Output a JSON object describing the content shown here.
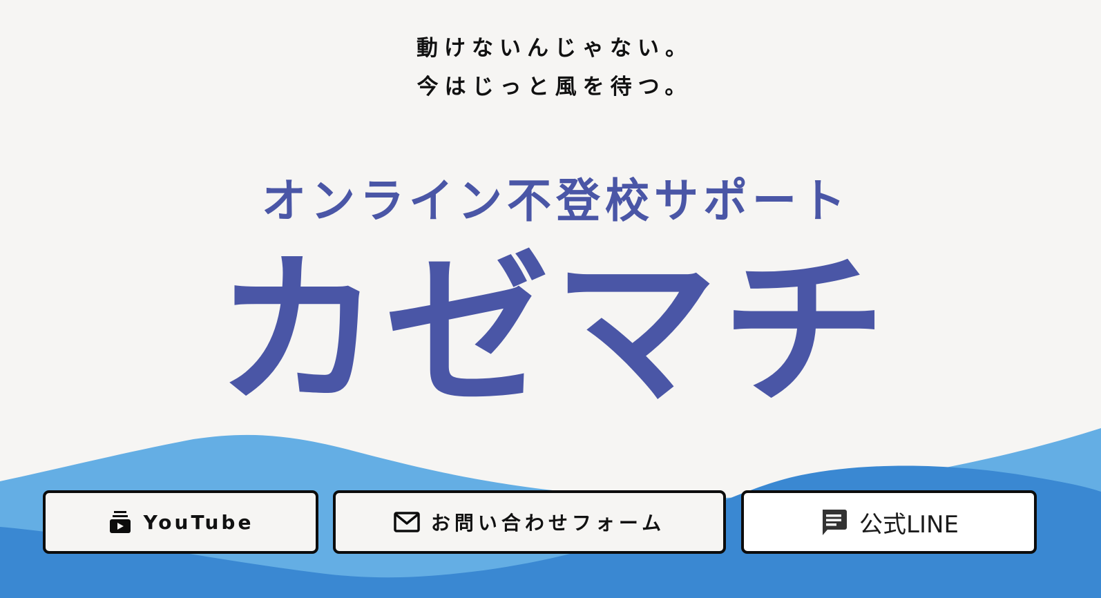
{
  "hero": {
    "tagline": [
      "動けないんじゃない。",
      "今はじっと風を待つ。"
    ],
    "subtitle": "オンライン不登校サポート",
    "title": "カゼマチ"
  },
  "buttons": [
    {
      "label": "YouTube",
      "icon": "youtube-subscriptions-icon"
    },
    {
      "label": "お問い合わせフォーム",
      "icon": "mail-icon"
    },
    {
      "label": "公式LINE",
      "icon": "chat-message-icon"
    }
  ],
  "colors": {
    "background": "#f6f5f3",
    "brand": "#4a56a6",
    "wave_light": "#64aee4",
    "wave_dark": "#3a88d2",
    "text": "#111111"
  }
}
